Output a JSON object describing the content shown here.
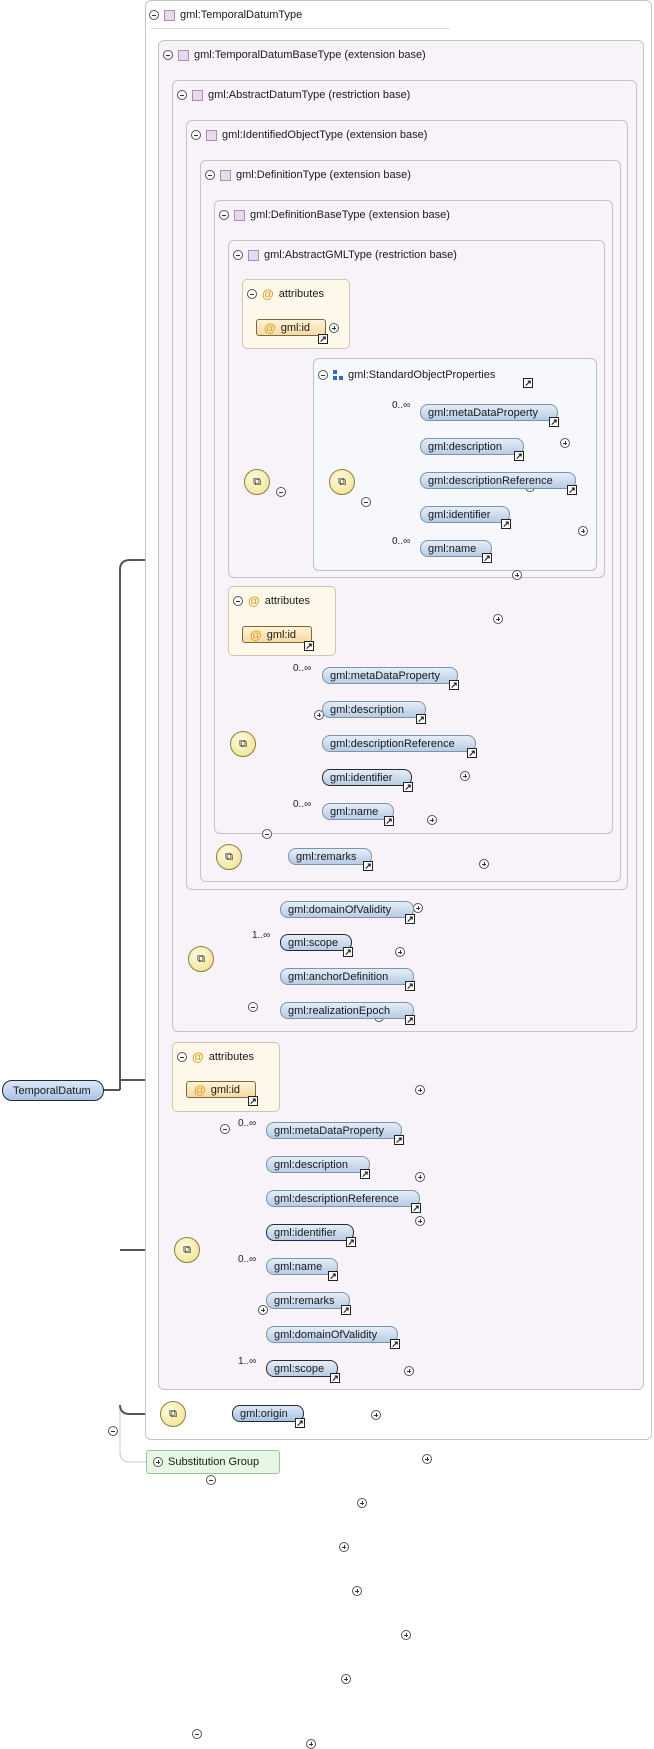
{
  "root": {
    "label": "TemporalDatum"
  },
  "types": {
    "temporal_datum_type": "gml:TemporalDatumType",
    "temporal_datum_base_type": "gml:TemporalDatumBaseType (extension base)",
    "abstract_datum_type": "gml:AbstractDatumType (restriction base)",
    "identified_object_type": "gml:IdentifiedObjectType (extension base)",
    "definition_type": "gml:DefinitionType (extension base)",
    "definition_base_type": "gml:DefinitionBaseType (extension base)",
    "abstract_gml_type": "gml:AbstractGMLType (restriction base)"
  },
  "attributes_label": "attributes",
  "attribute_id": "gml:id",
  "group": {
    "label": "gml:StandardObjectProperties"
  },
  "cardinality": {
    "many": "0..∞",
    "one_many": "1..∞"
  },
  "sop_elements": [
    "gml:metaDataProperty",
    "gml:description",
    "gml:descriptionReference",
    "gml:identifier",
    "gml:name"
  ],
  "def_elements": [
    "gml:metaDataProperty",
    "gml:description",
    "gml:descriptionReference",
    "gml:identifier",
    "gml:name"
  ],
  "remarks": "gml:remarks",
  "datum_elements": [
    "gml:domainOfValidity",
    "gml:scope",
    "gml:anchorDefinition",
    "gml:realizationEpoch"
  ],
  "restricted_elements": [
    "gml:metaDataProperty",
    "gml:description",
    "gml:descriptionReference",
    "gml:identifier",
    "gml:name",
    "gml:remarks",
    "gml:domainOfValidity",
    "gml:scope"
  ],
  "origin": "gml:origin",
  "substitution_group": "Substitution Group"
}
